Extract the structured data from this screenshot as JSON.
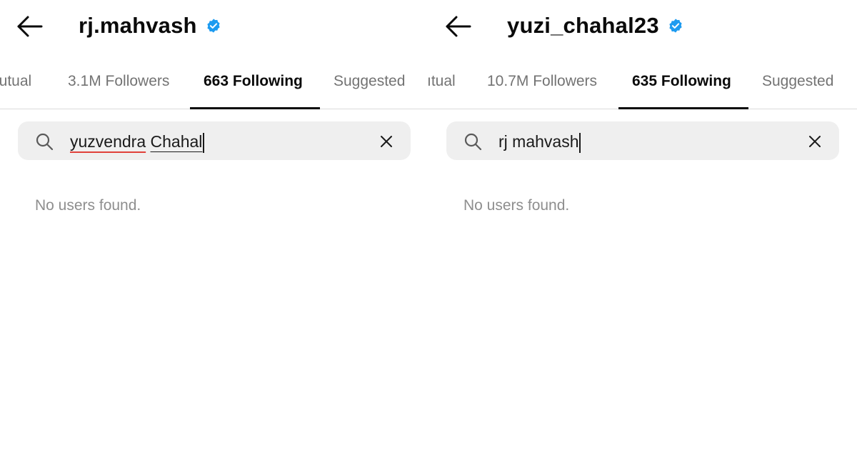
{
  "icons": {
    "back": "arrow-left-icon",
    "verified": "verified-badge-icon",
    "search": "search-icon",
    "clear": "close-icon"
  },
  "colors": {
    "verified": "#1d9bf0",
    "active_tab": "#0a0a0a",
    "inactive_tab": "#737373",
    "search_bg": "#efefef",
    "empty_text": "#8e8e8e",
    "spellcheck": "#e0413a"
  },
  "left_panel": {
    "username": "rj.mahvash",
    "verified": true,
    "tabs": [
      {
        "label": "lutual",
        "active": false
      },
      {
        "label": "3.1M Followers",
        "active": false
      },
      {
        "label": "663 Following",
        "active": true
      },
      {
        "label": "Suggested",
        "active": false
      }
    ],
    "search": {
      "query_part1": "yuzvendra",
      "query_part2": "Chahal"
    },
    "empty_message": "No users found."
  },
  "right_panel": {
    "username": "yuzi_chahal23",
    "verified": true,
    "tabs": [
      {
        "label": "ıtual",
        "active": false
      },
      {
        "label": "10.7M Followers",
        "active": false
      },
      {
        "label": "635 Following",
        "active": true
      },
      {
        "label": "Suggested",
        "active": false
      }
    ],
    "search": {
      "query": "rj mahvash"
    },
    "empty_message": "No users found."
  }
}
